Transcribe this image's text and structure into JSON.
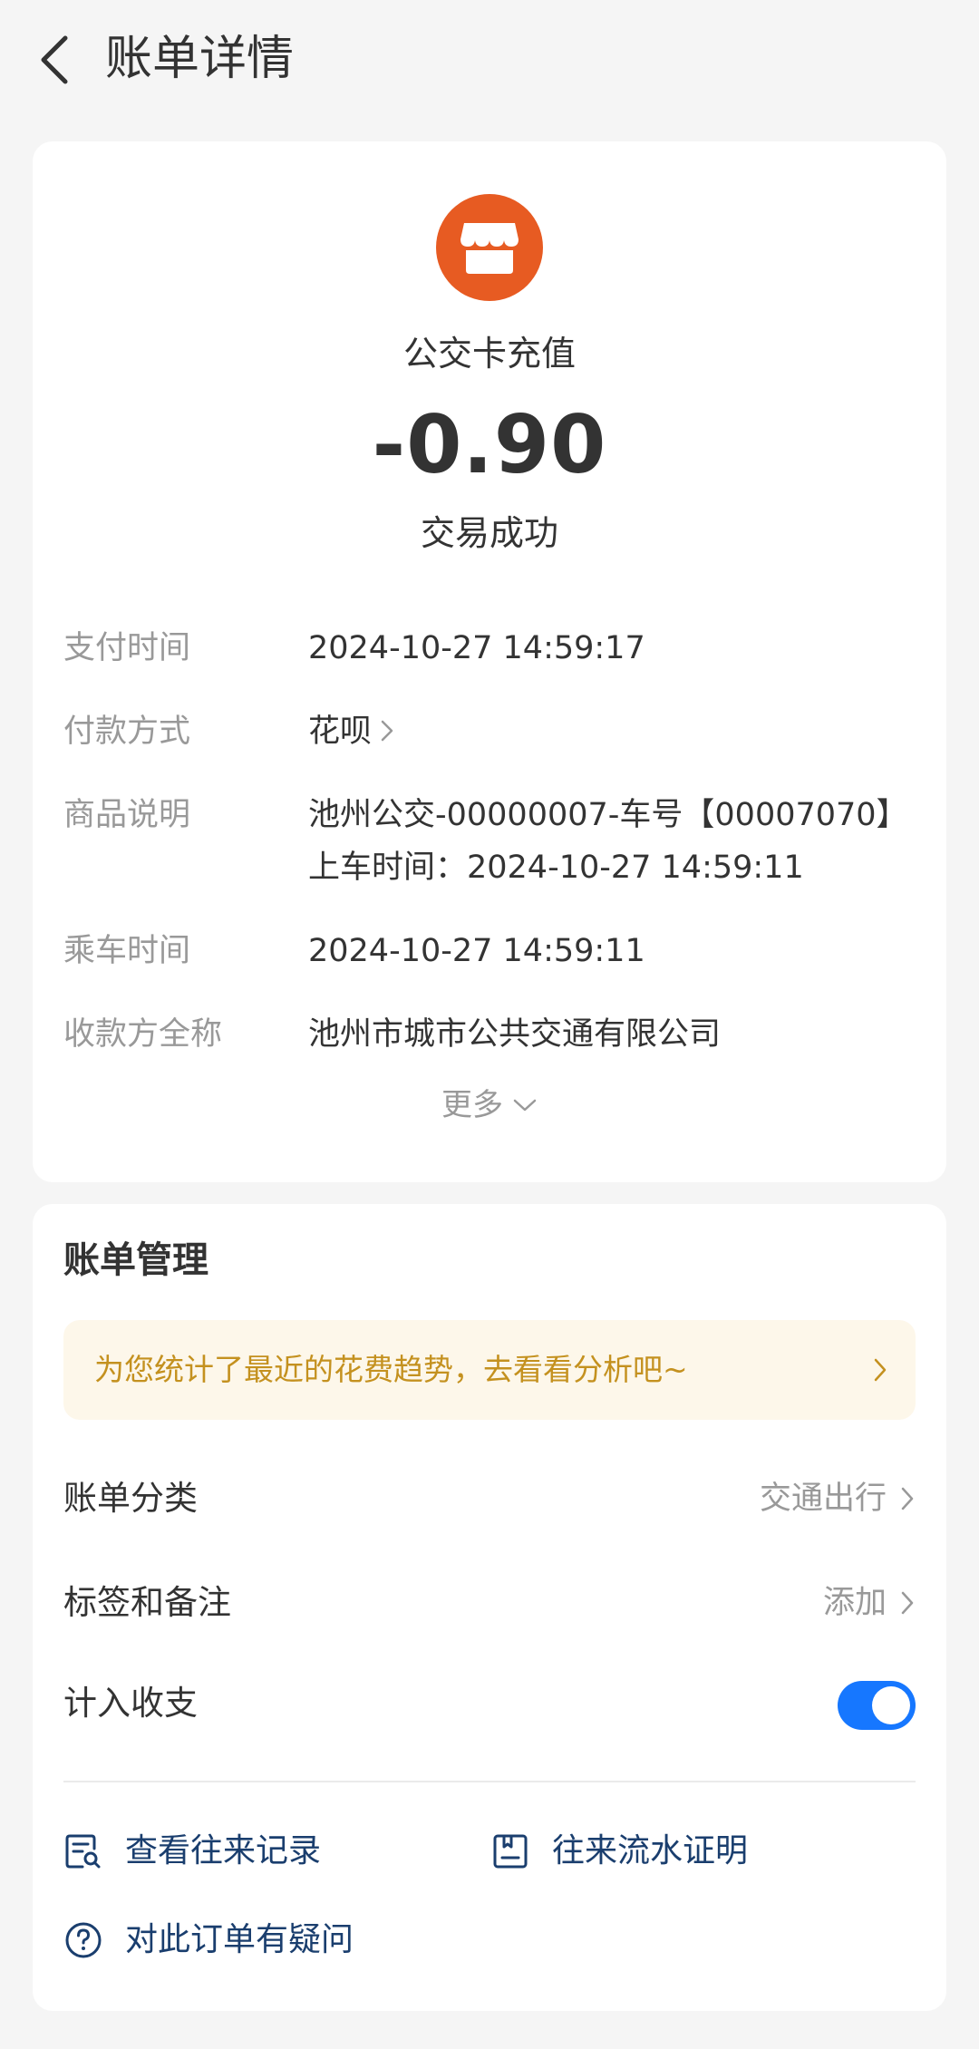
{
  "header": {
    "title": "账单详情"
  },
  "merchant": {
    "name": "公交卡充值",
    "amount": "-0.90",
    "status": "交易成功",
    "logo_icon": "storefront-icon",
    "logo_color": "#e75b22"
  },
  "details": [
    {
      "label": "支付时间",
      "value": "2024-10-27 14:59:17"
    },
    {
      "label": "付款方式",
      "value": "花呗"
    },
    {
      "label": "商品说明",
      "value": "池州公交-00000007-车号【00007070】上车时间：2024-10-27 14:59:11"
    },
    {
      "label": "乘车时间",
      "value": "2024-10-27 14:59:11"
    },
    {
      "label": "收款方全称",
      "value": "池州市城市公共交通有限公司"
    }
  ],
  "more": {
    "label": "更多"
  },
  "manage": {
    "title": "账单管理",
    "tip": "为您统计了最近的花费趋势，去看看分析吧~",
    "category_label": "账单分类",
    "category_value": "交通出行",
    "tags_label": "标签和备注",
    "tags_value": "添加",
    "include_label": "计入收支",
    "include_enabled": true,
    "toggle_color": "#1677ff"
  },
  "links": {
    "history": "查看往来记录",
    "proof": "往来流水证明",
    "question": "对此订单有疑问"
  }
}
